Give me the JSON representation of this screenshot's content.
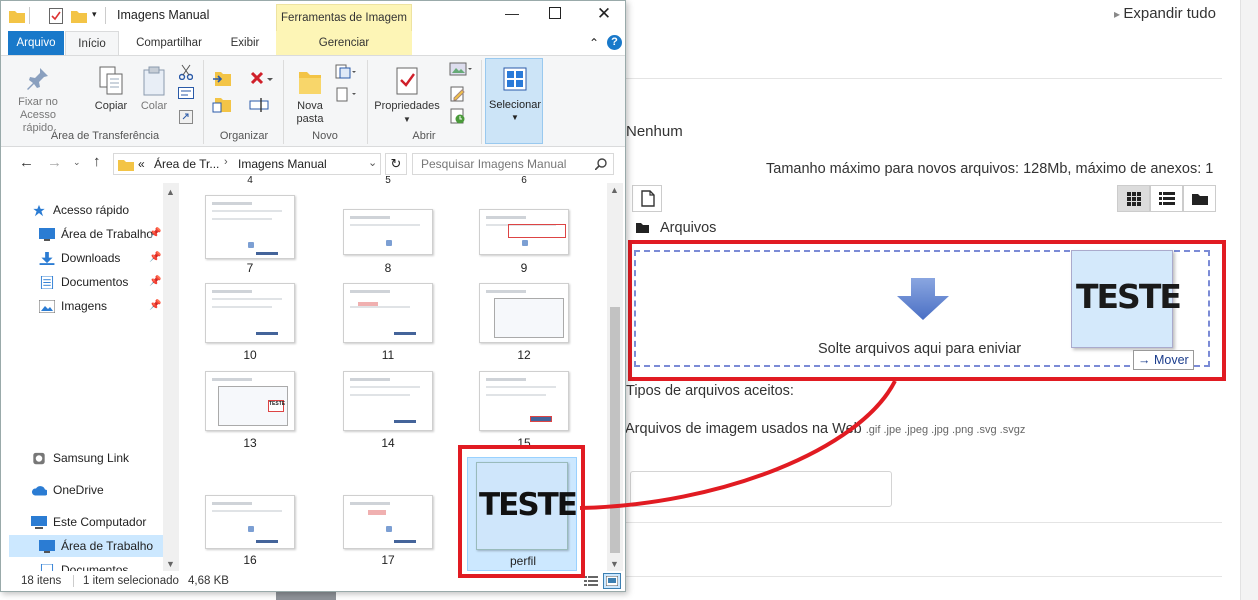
{
  "web": {
    "expand_all": "Expandir tudo",
    "none_text": "Nenhum",
    "max_size": "Tamanho máximo para novos arquivos: 128Mb, máximo de anexos: 1",
    "folder_label": "Arquivos",
    "drop_text": "Solte arquivos aqui para eniviar",
    "move_label": "Mover",
    "accepted_types": "Tipos de arquivos aceitos:",
    "image_files": "Arquivos de imagem usados na Web",
    "extensions": ".gif .jpe .jpeg .jpg .png .svg .svgz",
    "teste": "TESTE"
  },
  "window": {
    "title": "Imagens Manual",
    "contextual_tab": "Ferramentas de Imagem",
    "tabs": [
      "Arquivo",
      "Início",
      "Compartilhar",
      "Exibir",
      "Gerenciar"
    ],
    "ribbon": {
      "pin": "Fixar no Acesso rápido",
      "copy": "Copiar",
      "paste": "Colar",
      "new_folder": "Nova pasta",
      "properties": "Propriedades",
      "select": "Selecionar",
      "groups": [
        "Área de Transferência",
        "Organizar",
        "Novo",
        "Abrir"
      ]
    },
    "address": {
      "prefix": "«",
      "parent": "Área de Tr...",
      "current": "Imagens Manual",
      "search_placeholder": "Pesquisar Imagens Manual"
    },
    "nav": {
      "quick_access": "Acesso rápido",
      "items": [
        "Área de Trabalho",
        "Downloads",
        "Documentos",
        "Imagens"
      ],
      "samsung": "Samsung Link",
      "onedrive": "OneDrive",
      "this_pc": "Este Computador",
      "pc_items": [
        "Área de Trabalho",
        "Documentos"
      ]
    },
    "files": {
      "top_labels": [
        "4",
        "5",
        "6"
      ],
      "row1": [
        "7",
        "8",
        "9"
      ],
      "row2": [
        "10",
        "11",
        "12"
      ],
      "row3": [
        "13",
        "14",
        "15"
      ],
      "row4": [
        "16",
        "17",
        "perfil"
      ],
      "teste": "TESTE"
    },
    "status": {
      "count": "18 itens",
      "selected": "1 item selecionado",
      "size": "4,68 KB"
    }
  }
}
